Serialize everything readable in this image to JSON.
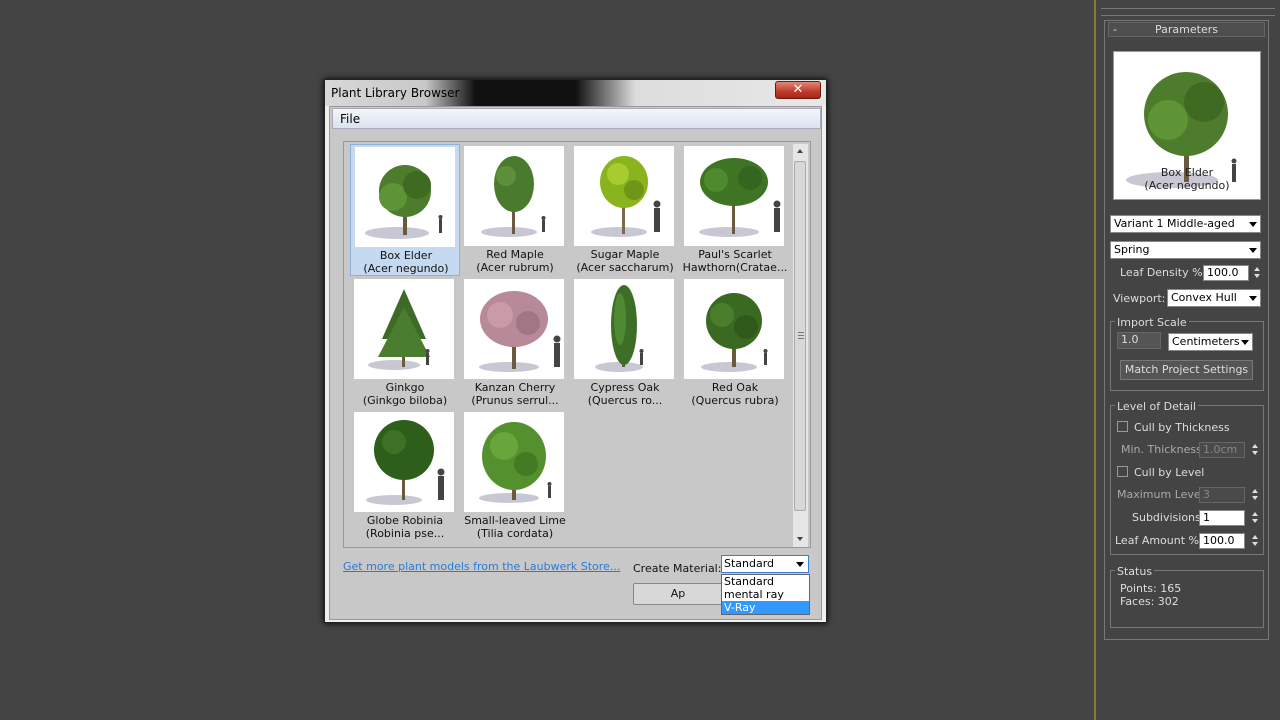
{
  "dialog": {
    "title": "Plant Library Browser",
    "close_glyph": "✕",
    "menu": {
      "file": "File"
    },
    "plants": [
      {
        "name": "Box Elder",
        "latin": "(Acer negundo)",
        "selected": true
      },
      {
        "name": "Red Maple",
        "latin": "(Acer rubrum)"
      },
      {
        "name": "Sugar Maple",
        "latin": "(Acer saccharum)"
      },
      {
        "name": "Paul's Scarlet",
        "latin": "Hawthorn(Cratae..."
      },
      {
        "name": "Ginkgo",
        "latin": "(Ginkgo biloba)"
      },
      {
        "name": "Kanzan Cherry",
        "latin": "(Prunus serrul..."
      },
      {
        "name": "Cypress Oak",
        "latin": "(Quercus ro..."
      },
      {
        "name": "Red Oak",
        "latin": "(Quercus rubra)"
      },
      {
        "name": "Globe Robinia",
        "latin": "(Robinia pse..."
      },
      {
        "name": "Small-leaved Lime",
        "latin": "(Tilia cordata)"
      }
    ],
    "store_link": "Get more plant models from the Laubwerk Store...",
    "create_material_label": "Create Material:",
    "create_material_value": "Standard",
    "create_material_options": [
      "Standard",
      "mental ray",
      "V-Ray"
    ],
    "highlighted_option": "V-Ray",
    "apply_label": "Ap"
  },
  "panel": {
    "rollout_minus": "-",
    "rollout_title": "Parameters",
    "preview_name": "Box Elder",
    "preview_latin": "(Acer negundo)",
    "variant": "Variant 1 Middle-aged",
    "season": "Spring",
    "leaf_density_label": "Leaf Density %:",
    "leaf_density_value": "100.0",
    "viewport_label": "Viewport:",
    "viewport_value": "Convex Hull",
    "import_scale": {
      "title": "Import Scale",
      "value": "1.0",
      "unit": "Centimeters",
      "match_button": "Match Project Settings"
    },
    "lod": {
      "title": "Level of Detail",
      "cull_thickness": "Cull by Thickness",
      "min_thickness_label": "Min. Thickness:",
      "min_thickness_value": "1.0cm",
      "cull_level": "Cull by Level",
      "max_level_label": "Maximum Level:",
      "max_level_value": "3",
      "subdivisions_label": "Subdivisions:",
      "subdivisions_value": "1",
      "leaf_amount_label": "Leaf Amount %:",
      "leaf_amount_value": "100.0"
    },
    "status": {
      "title": "Status",
      "points": "Points: 165",
      "faces": "Faces: 302"
    }
  },
  "colors": {
    "viewport_bg": "#444444",
    "selection": "#c5d9f1",
    "link": "#2a7ad8",
    "highlight": "#3399ff",
    "close_button": "#c0392b"
  }
}
